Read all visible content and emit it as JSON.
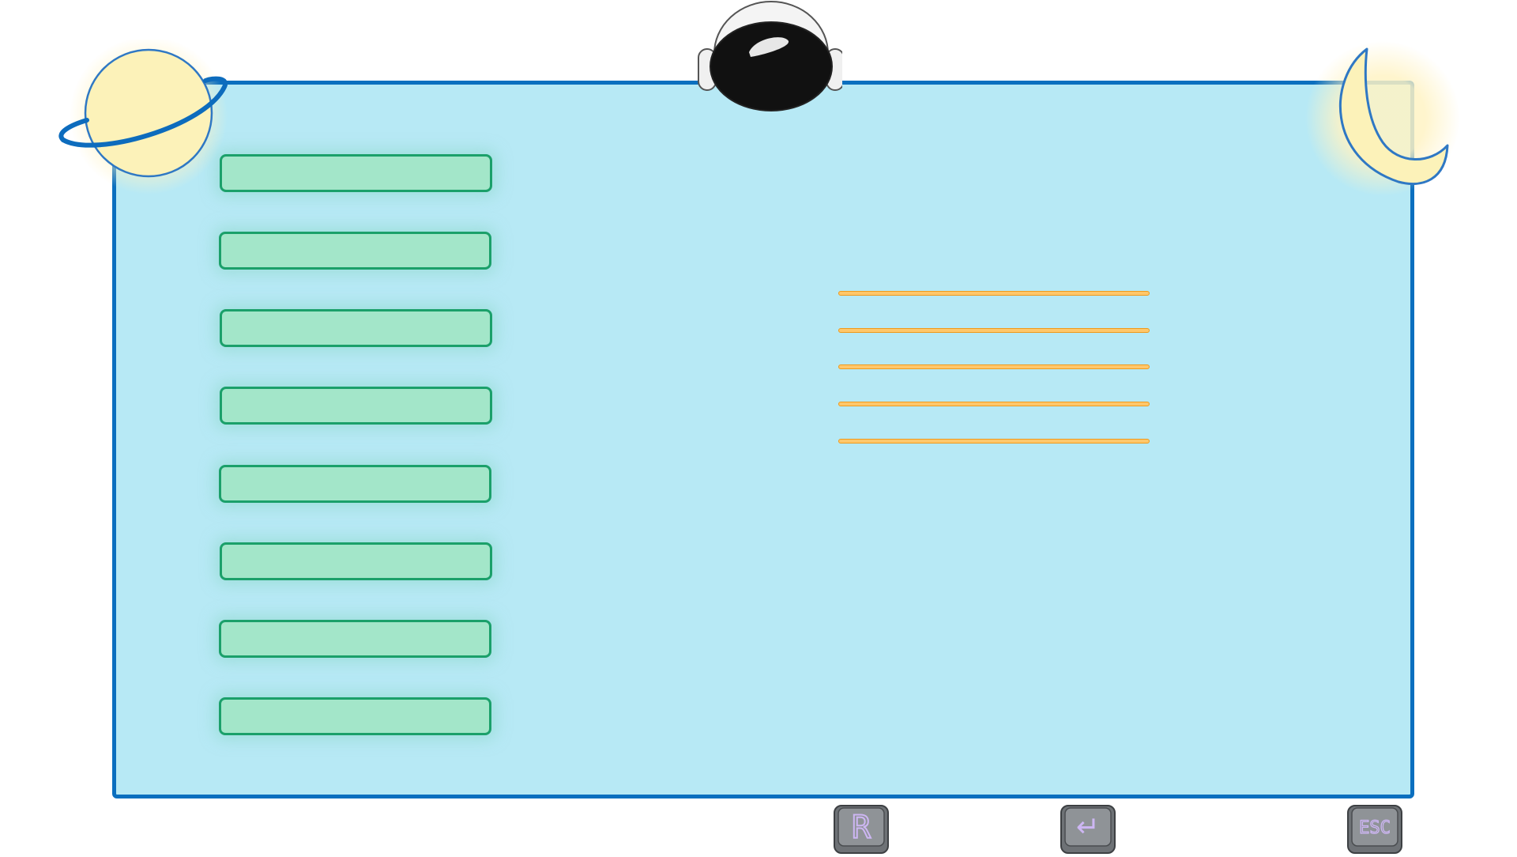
{
  "menu": {
    "items": [
      {
        "label": ""
      },
      {
        "label": ""
      },
      {
        "label": ""
      },
      {
        "label": ""
      },
      {
        "label": ""
      },
      {
        "label": ""
      },
      {
        "label": ""
      },
      {
        "label": ""
      }
    ]
  },
  "info_lines": {
    "count": 5
  },
  "keys": {
    "restart_label": "R",
    "enter_symbol": "↵",
    "escape_label": "ESC"
  },
  "colors": {
    "panel_bg": "#b7e9f5",
    "panel_border": "#0b6fbf",
    "button_fill": "#a3e6c9",
    "button_border": "#1ba06a",
    "line_fill": "#ffc76a",
    "line_border": "#ef9a1c",
    "planet": "#fcf2b9",
    "key_face": "#8f9397",
    "key_glyph": "#cdb6f3"
  },
  "icons": [
    "planet-icon",
    "astronaut-helmet-icon",
    "crescent-moon-icon"
  ]
}
